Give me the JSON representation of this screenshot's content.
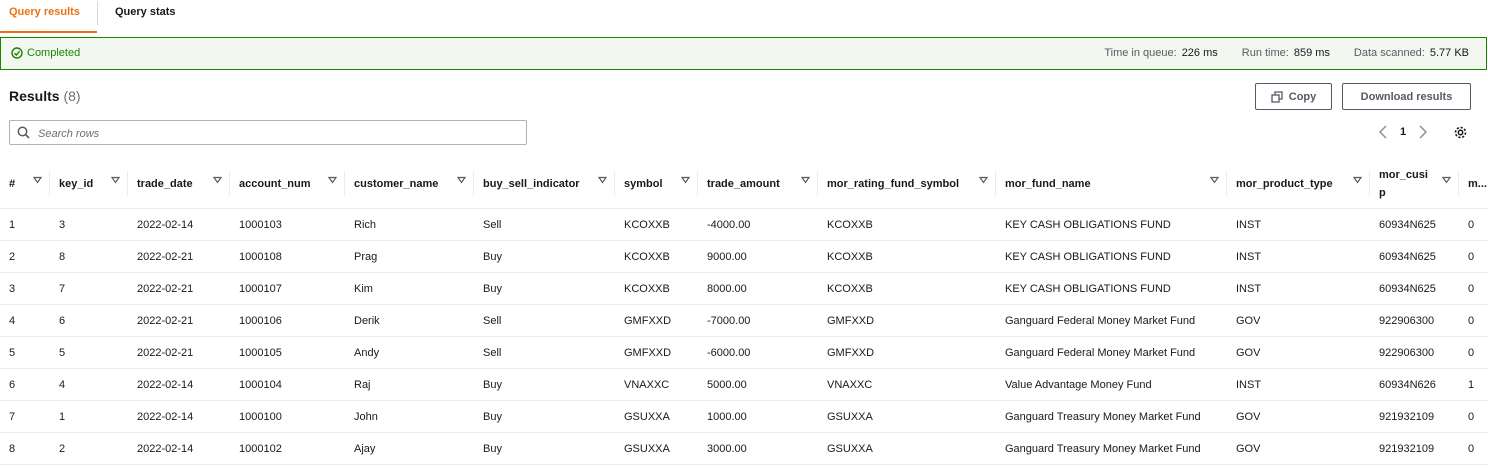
{
  "tabs": {
    "query_results": "Query results",
    "query_stats": "Query stats"
  },
  "status": {
    "label": "Completed",
    "queue_label": "Time in queue:",
    "queue_value": "226 ms",
    "runtime_label": "Run time:",
    "runtime_value": "859 ms",
    "scanned_label": "Data scanned:",
    "scanned_value": "5.77 KB"
  },
  "results": {
    "title": "Results",
    "count": "(8)"
  },
  "buttons": {
    "copy": "Copy",
    "download": "Download results"
  },
  "search": {
    "placeholder": "Search rows",
    "value": ""
  },
  "pagination": {
    "page": "1"
  },
  "columns": [
    "#",
    "key_id",
    "trade_date",
    "account_num",
    "customer_name",
    "buy_sell_indicator",
    "symbol",
    "trade_amount",
    "mor_rating_fund_symbol",
    "mor_fund_name",
    "mor_product_type",
    "mor_cusip",
    "m..."
  ],
  "rows": [
    [
      "1",
      "3",
      "2022-02-14",
      "1000103",
      "Rich",
      "Sell",
      "KCOXXB",
      "-4000.00",
      "KCOXXB",
      "KEY CASH OBLIGATIONS FUND",
      "INST",
      "60934N625",
      "0"
    ],
    [
      "2",
      "8",
      "2022-02-21",
      "1000108",
      "Prag",
      "Buy",
      "KCOXXB",
      "9000.00",
      "KCOXXB",
      "KEY CASH OBLIGATIONS FUND",
      "INST",
      "60934N625",
      "0"
    ],
    [
      "3",
      "7",
      "2022-02-21",
      "1000107",
      "Kim",
      "Buy",
      "KCOXXB",
      "8000.00",
      "KCOXXB",
      "KEY CASH OBLIGATIONS FUND",
      "INST",
      "60934N625",
      "0"
    ],
    [
      "4",
      "6",
      "2022-02-21",
      "1000106",
      "Derik",
      "Sell",
      "GMFXXD",
      "-7000.00",
      "GMFXXD",
      "Ganguard Federal Money Market Fund",
      "GOV",
      "922906300",
      "0"
    ],
    [
      "5",
      "5",
      "2022-02-21",
      "1000105",
      "Andy",
      "Sell",
      "GMFXXD",
      "-6000.00",
      "GMFXXD",
      "Ganguard Federal Money Market Fund",
      "GOV",
      "922906300",
      "0"
    ],
    [
      "6",
      "4",
      "2022-02-14",
      "1000104",
      "Raj",
      "Buy",
      "VNAXXC",
      "5000.00",
      "VNAXXC",
      "Value Advantage Money Fund",
      "INST",
      "60934N626",
      "1"
    ],
    [
      "7",
      "1",
      "2022-02-14",
      "1000100",
      "John",
      "Buy",
      "GSUXXA",
      "1000.00",
      "GSUXXA",
      "Ganguard Treasury Money Market Fund",
      "GOV",
      "921932109",
      "0"
    ],
    [
      "8",
      "2",
      "2022-02-14",
      "1000102",
      "Ajay",
      "Buy",
      "GSUXXA",
      "3000.00",
      "GSUXXA",
      "Ganguard Treasury Money Market Fund",
      "GOV",
      "921932109",
      "0"
    ]
  ],
  "colors": {
    "accent": "#ec7211",
    "success": "#1d8102",
    "success_bg": "#f2f8f0"
  }
}
